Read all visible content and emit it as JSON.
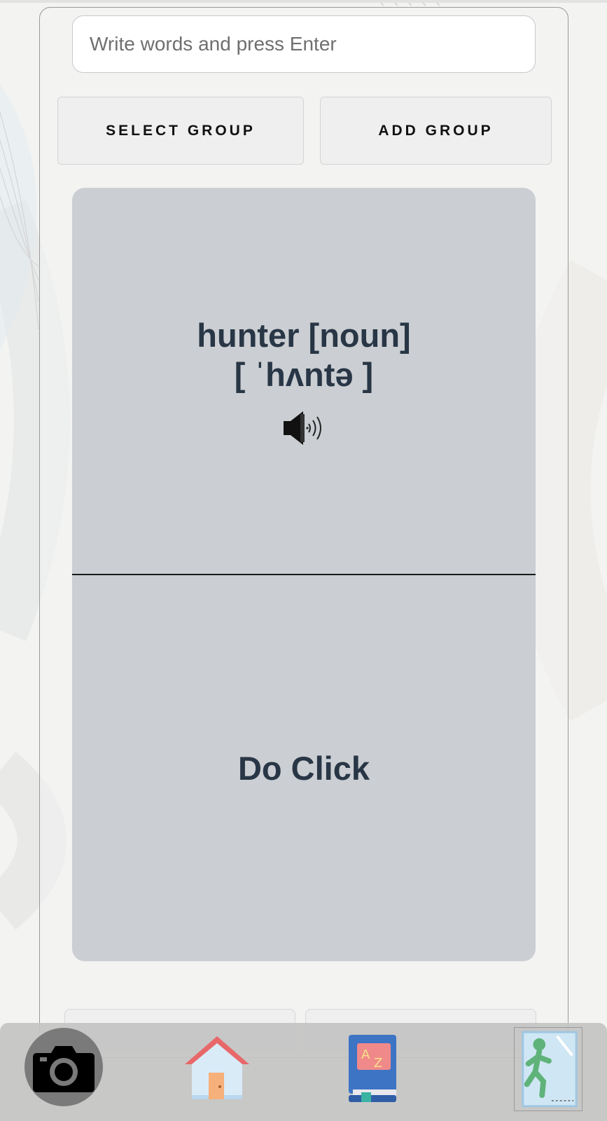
{
  "input": {
    "placeholder": "Write words and press Enter"
  },
  "buttons": {
    "select_group": "SELECT GROUP",
    "add_group": "ADD GROUP"
  },
  "card": {
    "word": "hunter [noun]",
    "ipa": "[ ˈhʌntə ]",
    "back_text": "Do Click"
  },
  "icons": {
    "speaker": "speaker-icon",
    "camera": "camera-icon",
    "home": "home-icon",
    "dictionary": "dictionary-icon",
    "exit": "exit-icon"
  },
  "colors": {
    "card_bg": "#cbced2",
    "card_text": "#283646",
    "button_bg": "#efefef",
    "nav_bg": "#c4c4c4"
  }
}
